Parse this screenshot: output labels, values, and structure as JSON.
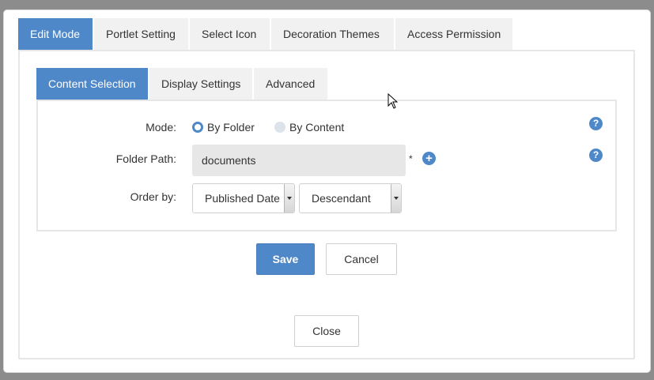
{
  "outer_tabs": [
    "Edit Mode",
    "Portlet Setting",
    "Select Icon",
    "Decoration Themes",
    "Access Permission"
  ],
  "inner_tabs": [
    "Content Selection",
    "Display Settings",
    "Advanced"
  ],
  "form": {
    "mode_label": "Mode:",
    "mode_option_folder": "By Folder",
    "mode_option_content": "By Content",
    "mode_selected": "By Folder",
    "folder_path_label": "Folder Path:",
    "folder_path_value": "documents",
    "required_mark": "*",
    "order_by_label": "Order by:",
    "order_field": "Published Date",
    "order_direction": "Descendant"
  },
  "icons": {
    "help": "?",
    "add": "+"
  },
  "buttons": {
    "save": "Save",
    "cancel": "Cancel",
    "close": "Close"
  },
  "colors": {
    "accent": "#4f88c9",
    "tab_inactive": "#f1f1f1",
    "input_bg": "#e7e7e7"
  }
}
